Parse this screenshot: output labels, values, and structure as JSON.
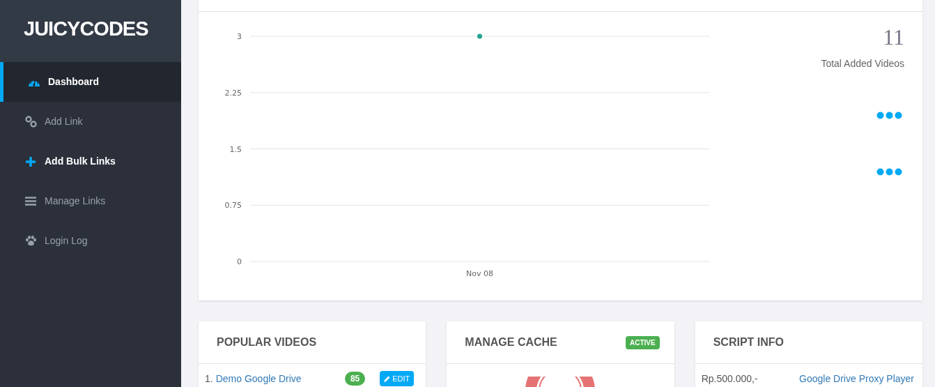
{
  "brand": "JUICYCODES",
  "sidebar": {
    "items": [
      {
        "kind": "gauge",
        "label": "Dashboard",
        "selected": true,
        "bold": true
      },
      {
        "kind": "link",
        "label": "Add Link",
        "selected": false,
        "bold": false
      },
      {
        "kind": "plus",
        "label": "Add Bulk Links",
        "selected": false,
        "bold": true
      },
      {
        "kind": "bars",
        "label": "Manage Links",
        "selected": false,
        "bold": false
      },
      {
        "kind": "paw",
        "label": "Login Log",
        "selected": false,
        "bold": false
      }
    ]
  },
  "stats_chart": {
    "chart_data": {
      "type": "line",
      "categories": [
        "Nov 08"
      ],
      "grid": true,
      "series": [
        {
          "color": "#1fa38e",
          "marker": true,
          "values": [
            3
          ]
        }
      ],
      "ylim": [
        0,
        3
      ],
      "yticks": [
        {
          "value": 0,
          "label": "0"
        },
        {
          "value": 0.75,
          "label": "0.75"
        },
        {
          "value": 1.5,
          "label": "1.5"
        },
        {
          "value": 2.25,
          "label": "2.25"
        },
        {
          "value": 3,
          "label": "3"
        }
      ]
    }
  },
  "stats": {
    "total": "11",
    "total_label": "Total Added Videos"
  },
  "popular_videos": {
    "title": "POPULAR VIDEOS",
    "rows": [
      {
        "number": "1.",
        "title": "Demo Google Drive",
        "views": "85",
        "action": "EDIT"
      }
    ]
  },
  "manage_cache": {
    "title": "MANAGE CACHE",
    "status": "ACTIVE"
  },
  "script_info": {
    "title": "SCRIPT INFO",
    "rows": [
      {
        "price": "Rp.500.000,-",
        "product": "Google Drive Proxy Player"
      }
    ]
  }
}
